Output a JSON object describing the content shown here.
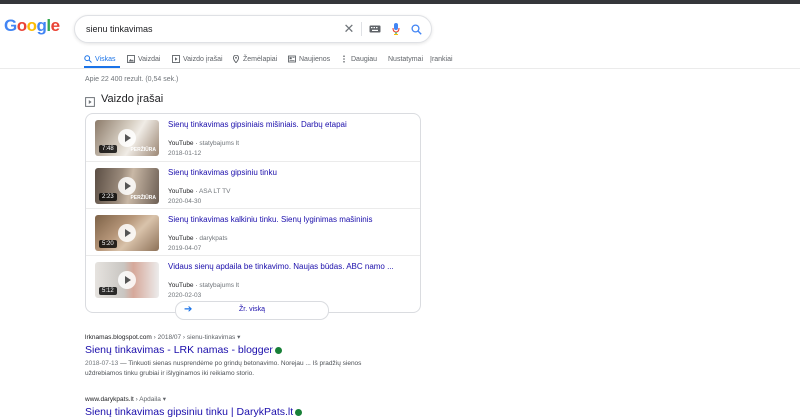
{
  "logo": {
    "letters": [
      "G",
      "o",
      "o",
      "g",
      "l",
      "e"
    ],
    "colors": [
      "#4285f4",
      "#ea4335",
      "#fbbc05",
      "#4285f4",
      "#34a853",
      "#ea4335"
    ]
  },
  "search": {
    "query": "sienu tinkavimas"
  },
  "tabs": [
    {
      "label": "Viskas",
      "icon": "search-icon"
    },
    {
      "label": "Vaizdai",
      "icon": "image-icon"
    },
    {
      "label": "Vaizdo įrašai",
      "icon": "video-icon"
    },
    {
      "label": "Žemėlapiai",
      "icon": "map-pin-icon"
    },
    {
      "label": "Naujienos",
      "icon": "news-icon"
    },
    {
      "label": "Daugiau",
      "icon": "more-vert-icon"
    },
    {
      "label": "Nustatymai"
    },
    {
      "label": "Įrankiai"
    }
  ],
  "stats": "Apie 22 400 rezult. (0,54 sek.)",
  "videos": {
    "heading": "Vaizdo įrašai",
    "items": [
      {
        "title": "Sienų tinkavimas gipsiniais mišiniais. Darbų etapai",
        "source": "YouTube",
        "channel": "statybajums lt",
        "date": "2018-01-12",
        "duration": "7:48",
        "preview": "PERŽIŪRA",
        "thumb_color": "#b7aa9a"
      },
      {
        "title": "Sienų tinkavimas gipsiniu tinku",
        "source": "YouTube",
        "channel": "ASA LT TV",
        "date": "2020-04-30",
        "duration": "2:23",
        "preview": "PERŽIŪRA",
        "thumb_color": "#7a6c61"
      },
      {
        "title": "Sienų tinkavimas kalkiniu tinku. Sienų lyginimas mašininis",
        "source": "YouTube",
        "channel": "darykpats",
        "date": "2019-04-07",
        "duration": "5:20",
        "preview": "",
        "thumb_color": "#a08468"
      },
      {
        "title": "Vidaus sienų apdaila be tinkavimo. Naujas būdas. ABC namo ...",
        "source": "YouTube",
        "channel": "statybajums lt",
        "date": "2020-02-03",
        "duration": "5:12",
        "preview": "",
        "thumb_color": "#cfcfcf"
      }
    ],
    "see_all": "Žr. viską"
  },
  "results": [
    {
      "domain": "lrknamas.blogspot.com",
      "crumb": "› 2018/07 › sienu-tinkavimas",
      "title": "Sienų tinkavimas - LRK namas - blogger",
      "date": "2018-07-13",
      "snippet": "— Tinkuoti sienas nusprendėme po grindų betonavimo. Norejau ... Iš pradžių sienos uždrebiamos tinku grubiai ir išlyginamos iki reikiamo storio."
    },
    {
      "domain": "www.darykpats.lt",
      "crumb": "› Apdaila",
      "title": "Sienų tinkavimas gipsiniu tinku | DarykPats.lt"
    }
  ]
}
